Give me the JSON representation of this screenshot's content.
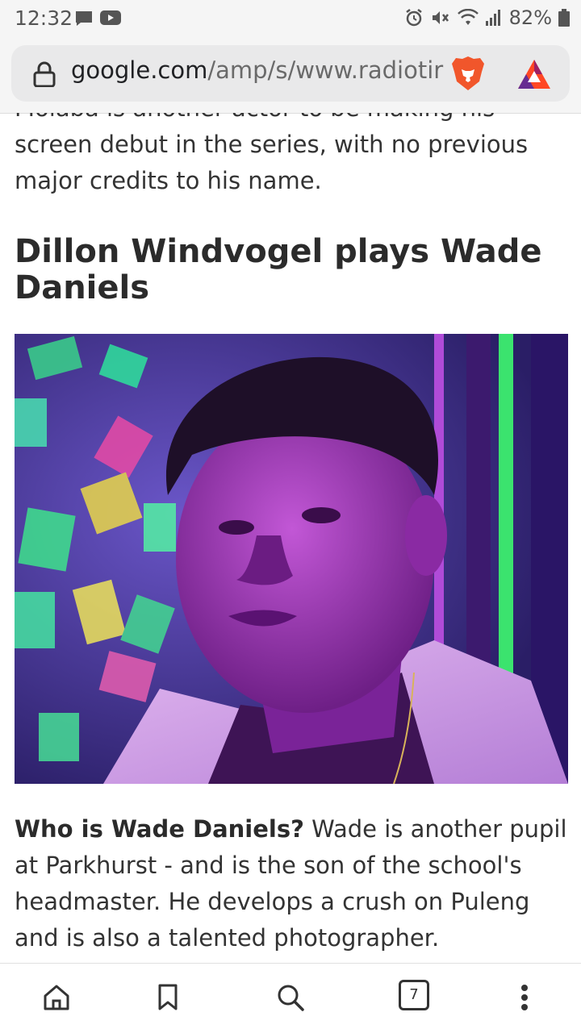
{
  "status_bar": {
    "time": "12:32",
    "battery": "82%",
    "left_icons": [
      "message-icon",
      "youtube-icon"
    ],
    "right_icons": [
      "alarm-icon",
      "mute-icon",
      "wifi-icon",
      "signal-icon",
      "battery-icon"
    ]
  },
  "address_bar": {
    "host": "google.com",
    "path": "/amp/s/www.radiotir"
  },
  "article": {
    "partial_top": "Molaba is another actor to be making his screen debut in the series, with no previous major credits to his name.",
    "heading": "Dillon Windvogel plays Wade Daniels",
    "image_alt": "Dillon Windvogel as Wade Daniels",
    "bold_lead": "Who is Wade Daniels?",
    "body": " Wade is another pupil at Parkhurst - and is the son of the school's headmaster. He develops a crush on Puleng and is also a talented photographer."
  },
  "bottom_nav": {
    "tab_count": "7",
    "items": [
      "home-icon",
      "bookmark-icon",
      "search-icon",
      "tabs-button",
      "menu-icon"
    ]
  }
}
